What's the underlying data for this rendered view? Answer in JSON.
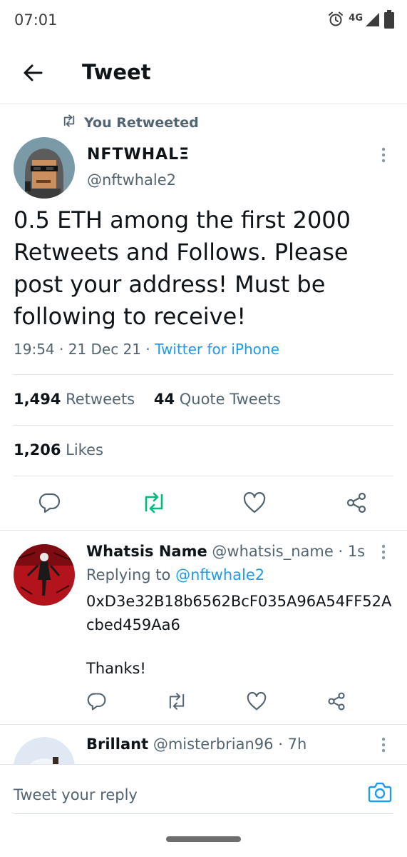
{
  "status_bar": {
    "time": "07:01",
    "network": "4G",
    "icons": [
      "alarm-icon",
      "signal-icon",
      "battery-icon"
    ]
  },
  "header": {
    "title": "Tweet",
    "back_icon": "arrow-left-icon"
  },
  "tweet": {
    "retweet_context": "You Retweeted",
    "author_name": "NFTWHALΞ",
    "author_handle": "@nftwhale2",
    "text": "0.5 ETH among the first 2000 Retweets and Follows. Please post your address! Must be following to receive!",
    "time": "19:54",
    "date": "21 Dec 21",
    "source": "Twitter for iPhone",
    "retweets_count": "1,494",
    "retweets_label": "Retweets",
    "quotes_count": "44",
    "quotes_label": "Quote Tweets",
    "likes_count": "1,206",
    "likes_label": "Likes",
    "retweeted_by_me": true
  },
  "replies": [
    {
      "name": "Whatsis Name",
      "handle": "@whatsis_name",
      "time": "1s",
      "replying_label": "Replying to",
      "replying_to": "@nftwhale2",
      "text": "0xD3e32B18b6562BcF035A96A54FF52Acbed459Aa6",
      "text2": "Thanks!"
    },
    {
      "name": "Brillant",
      "handle": "@misterbrian96",
      "time": "7h"
    }
  ],
  "reply_bar": {
    "placeholder": "Tweet your reply"
  },
  "colors": {
    "accent": "#1d9bf0",
    "retweet_green": "#00ba7c",
    "secondary_text": "#536471",
    "primary_text": "#0f1419"
  }
}
